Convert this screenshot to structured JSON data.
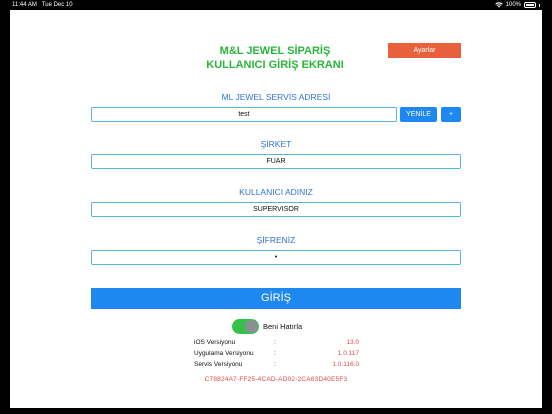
{
  "status_bar": {
    "time": "11:44 AM",
    "date": "Tue Dec 10",
    "battery": "100%"
  },
  "header": {
    "title_line1": "M&L JEWEL SİPARİŞ",
    "title_line2": "KULLANICI GİRİŞ EKRANI",
    "settings_label": "Ayarlar"
  },
  "service": {
    "label": "ML JEWEL SERVİS ADRESİ",
    "value": "test",
    "refresh_label": "YENİLE",
    "add_label": "+"
  },
  "company": {
    "label": "ŞİRKET",
    "value": "FUAR"
  },
  "username": {
    "label": "KULLANICI ADINIZ",
    "value": "SUPERVISOR"
  },
  "password": {
    "label": "ŞİFRENİZ",
    "value": "•"
  },
  "login": {
    "label": "GİRİŞ"
  },
  "remember": {
    "label": "Beni Hatırla",
    "on": true
  },
  "versions": [
    {
      "key": "iOS Versiyonu",
      "sep": ":",
      "value": "13.0"
    },
    {
      "key": "Uygulama Versiyonu",
      "sep": ":",
      "value": "1.0.117"
    },
    {
      "key": "Servis Versiyonu",
      "sep": ":",
      "value": "1.0.116.0"
    }
  ],
  "device_id": "C78824A7-FF25-4CAD-AD02-2CA63D40E5F3",
  "colors": {
    "accent_blue": "#1e88f0",
    "title_green": "#2ab53b",
    "settings_orange": "#e8603c",
    "error_red": "#e04a4a"
  }
}
